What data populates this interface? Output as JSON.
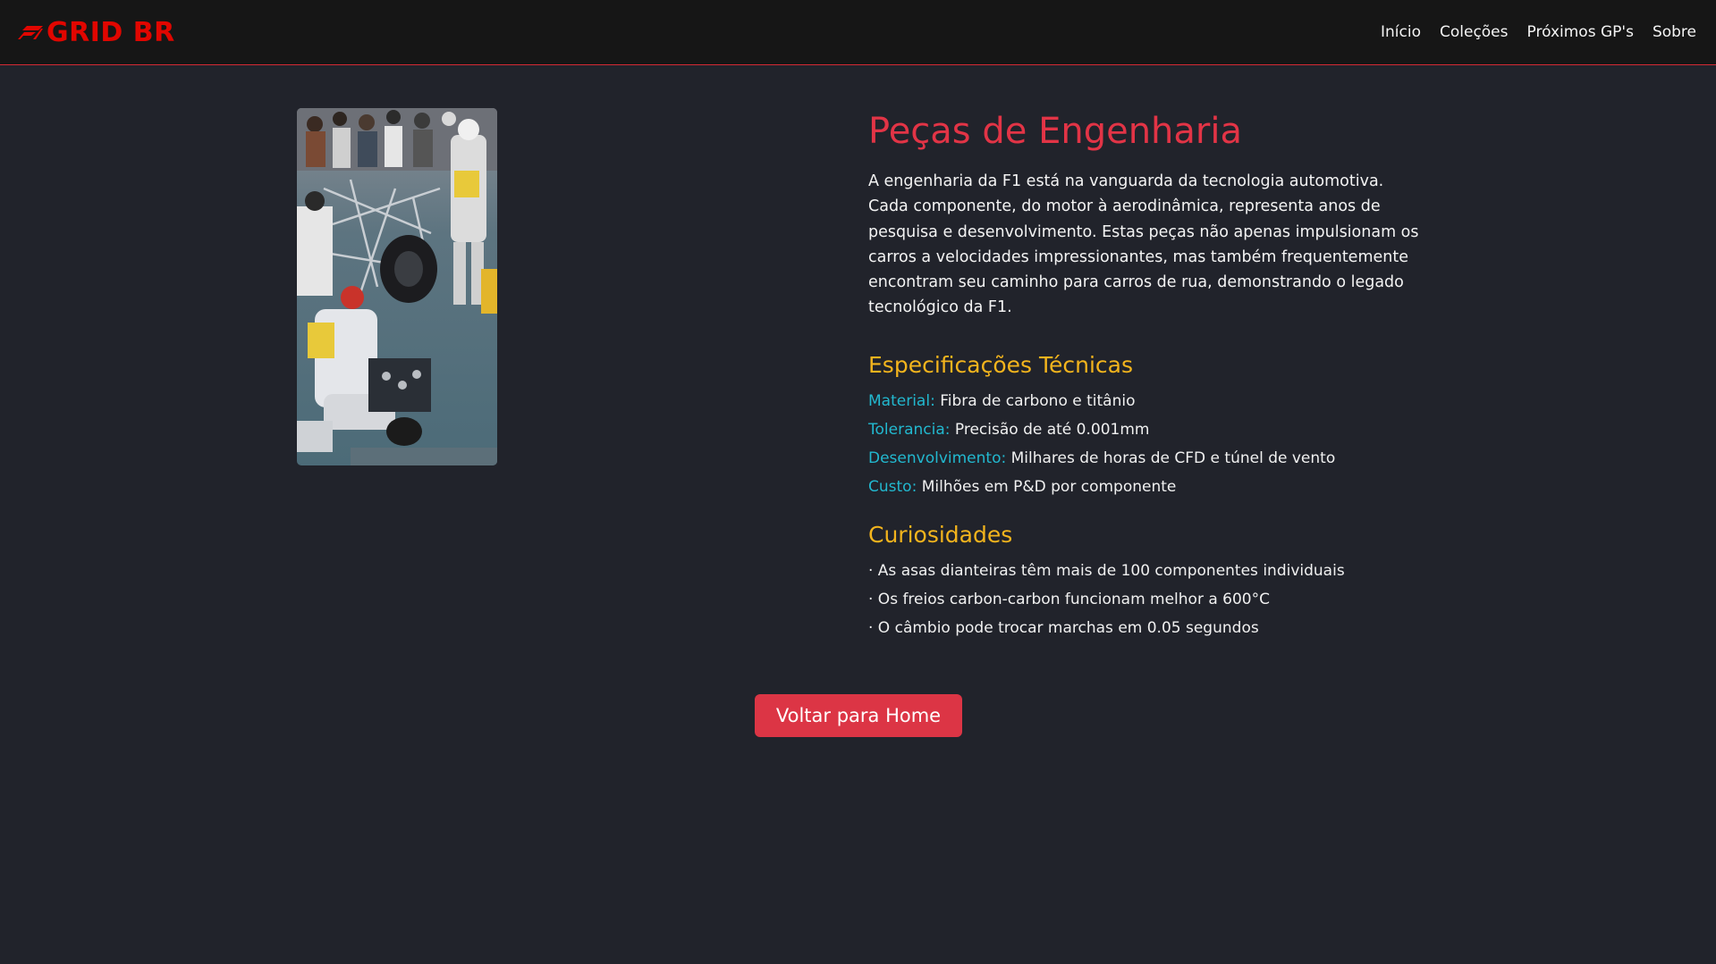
{
  "navbar": {
    "brand_text": "GRID BR",
    "brand_color": "#e10600",
    "links": [
      {
        "label": "Início"
      },
      {
        "label": "Coleções"
      },
      {
        "label": "Próximos GP's"
      },
      {
        "label": "Sobre"
      }
    ]
  },
  "photo": {
    "icon": "pit-crew-photo"
  },
  "detail": {
    "title": "Peças de Engenharia",
    "description": "A engenharia da F1 está na vanguarda da tecnologia automotiva. Cada componente, do motor à aerodinâmica, representa anos de pesquisa e desenvolvimento. Estas peças não apenas impulsionam os carros a velocidades impressionantes, mas também frequentemente encontram seu caminho para carros de rua, demonstrando o legado tecnológico da F1.",
    "specs_title": "Especificações Técnicas",
    "specs": [
      {
        "key": "Material:",
        "value": " Fibra de carbono e titânio"
      },
      {
        "key": "Tolerancia:",
        "value": " Precisão de até 0.001mm"
      },
      {
        "key": "Desenvolvimento:",
        "value": " Milhares de horas de CFD e túnel de vento"
      },
      {
        "key": "Custo:",
        "value": " Milhões em P&D por componente"
      }
    ],
    "curio_title": "Curiosidades",
    "curiosities": [
      "· As asas dianteiras têm mais de 100 componentes individuais",
      "· Os freios carbon-carbon funcionam melhor a 600°C",
      "· O câmbio pode trocar marchas em 0.05 segundos"
    ]
  },
  "back_button": {
    "label": "Voltar para Home"
  },
  "colors": {
    "background": "#21232b",
    "navbar": "#161616",
    "accent_red": "#e23446",
    "accent_yellow": "#f3b41d",
    "accent_cyan": "#22b8cf",
    "button": "#dc3545"
  }
}
